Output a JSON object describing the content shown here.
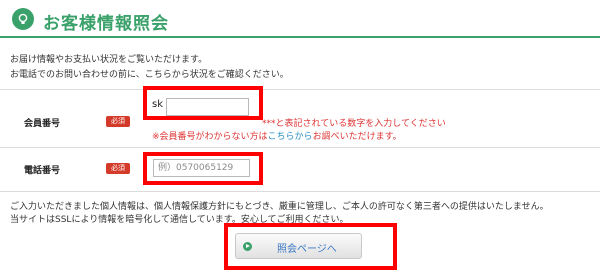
{
  "header": {
    "title": "お客様情報照会",
    "icon": "lightbulb-icon",
    "accent_color": "#3aa16a"
  },
  "intro": {
    "line1": "お届け情報やお支払い状況をご覧いただけます。",
    "line2": "お電話でのお問い合わせの前に、こちらから状況をご確認ください。"
  },
  "form": {
    "member": {
      "label": "会員番号",
      "badge": "必須",
      "prefix": "sk",
      "value": "",
      "hint": "***と表記されている数字を入力してください",
      "note_before": "※会員番号がわからない方は",
      "note_link": "こちらから",
      "note_after": "お調べいただけます。"
    },
    "phone": {
      "label": "電話番号",
      "badge": "必須",
      "placeholder": "例）0570065129",
      "value": ""
    }
  },
  "privacy": {
    "line1": "ご入力いただきました個人情報は、個人情報保護方針にもとづき、厳重に管理し、ご本人の許可なく第三者への提供はいたしません。",
    "line2": "当サイトはSSLにより情報を暗号化して通信しています。安心してご利用ください。"
  },
  "submit": {
    "label": "照会ページへ",
    "icon": "arrow-right-circle-icon"
  },
  "colors": {
    "badge": "#d43a2a",
    "highlight": "#ff0000",
    "hint": "#dd3333",
    "link": "#2f8fc7"
  }
}
